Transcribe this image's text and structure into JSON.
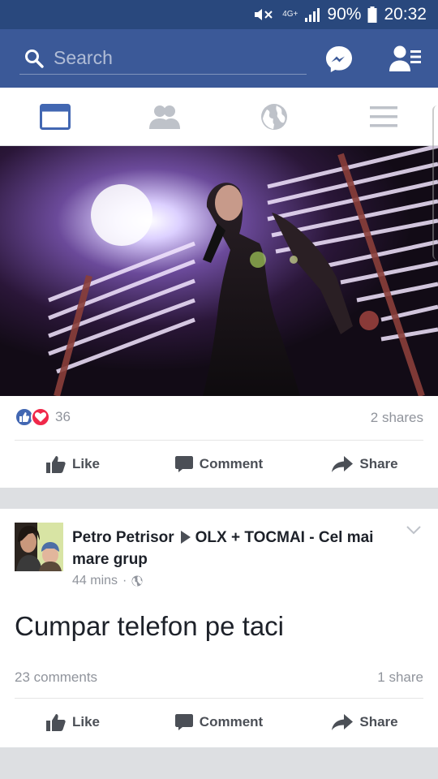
{
  "status": {
    "network": "4G+",
    "battery": "90%",
    "time": "20:32"
  },
  "header": {
    "search_placeholder": "Search"
  },
  "tabs": [
    {
      "name": "news-feed",
      "active": true
    },
    {
      "name": "friends",
      "active": false
    },
    {
      "name": "notifications",
      "active": false
    },
    {
      "name": "menu",
      "active": false
    }
  ],
  "post1": {
    "reaction_count": "36",
    "shares": "2 shares",
    "actions": {
      "like": "Like",
      "comment": "Comment",
      "share": "Share"
    }
  },
  "post2": {
    "author": "Petro Petrisor",
    "group": "OLX + TOCMAI - Cel mai mare grup",
    "time": "44 mins",
    "text": "Cumpar telefon pe taci",
    "comments": "23 comments",
    "shares": "1 share",
    "actions": {
      "like": "Like",
      "comment": "Comment",
      "share": "Share"
    }
  },
  "colors": {
    "brand": "#3b5998",
    "statusbar": "#29487d",
    "love": "#f0284a",
    "like": "#4267b2"
  }
}
